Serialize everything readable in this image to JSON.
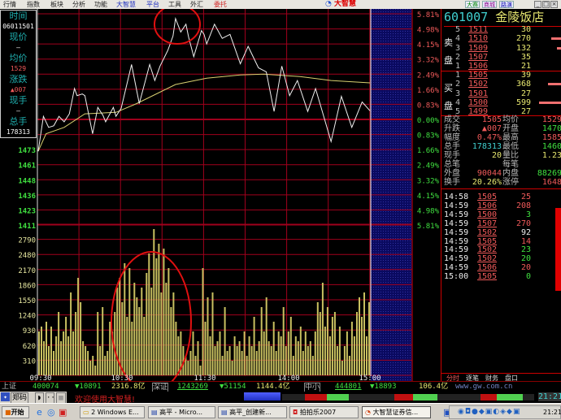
{
  "menu": {
    "items": [
      "行情",
      "指数",
      "板块",
      "分析",
      "功能",
      "大智慧",
      "平台",
      "工具",
      "外汇",
      "委托"
    ],
    "logo": "大智慧",
    "top_buttons": [
      "大赛",
      "商城",
      "路演"
    ],
    "window": [
      "_",
      "□",
      "×"
    ]
  },
  "info": {
    "time_label": "时间",
    "time_value": "06011501",
    "price_label": "现价",
    "price_value": "—",
    "avg_label": "均价",
    "avg_value": "1529",
    "chg_label": "涨跌",
    "chg_value": "▲007",
    "vol_label": "现手",
    "vol_value": "—",
    "total_label": "总手",
    "total_value": "178313"
  },
  "axes": {
    "price_labels": [
      "1473",
      "1461",
      "1448",
      "1436",
      "1423",
      "1411"
    ],
    "pct_labels": [
      "5.81%",
      "4.98%",
      "4.15%",
      "3.32%",
      "2.49%",
      "1.66%",
      "0.83%",
      "0.00%",
      "0.83%",
      "1.66%",
      "2.49%",
      "3.32%",
      "4.15%",
      "4.98%",
      "5.81%"
    ],
    "volume_labels": [
      "2790",
      "2480",
      "2170",
      "1860",
      "1550",
      "1240",
      "930",
      "620",
      "310"
    ],
    "time_labels": [
      "09:30",
      "10:30",
      "11:30",
      "14:00",
      "15:00"
    ]
  },
  "chart_data": {
    "type": "line",
    "pct_range": [
      -5.81,
      5.81
    ],
    "volume_max": 3100,
    "price_pct": [
      [
        0,
        -1.75
      ],
      [
        2,
        0.17
      ],
      [
        4,
        -0.44
      ],
      [
        6,
        -0.35
      ],
      [
        8,
        0.17
      ],
      [
        10,
        -0.13
      ],
      [
        12,
        0.31
      ],
      [
        14,
        1.7
      ],
      [
        15,
        1.31
      ],
      [
        17,
        1.4
      ],
      [
        18,
        1.31
      ],
      [
        21,
        -0.79
      ],
      [
        23,
        0.66
      ],
      [
        25,
        0.22
      ],
      [
        26,
        -0.13
      ],
      [
        29,
        0.66
      ],
      [
        30,
        0.17
      ],
      [
        32,
        0.61
      ],
      [
        36,
        3.02
      ],
      [
        39,
        0.87
      ],
      [
        43,
        3.02
      ],
      [
        45,
        2.14
      ],
      [
        47,
        2.93
      ],
      [
        50,
        3.8
      ],
      [
        52,
        4.59
      ],
      [
        53,
        5.55
      ],
      [
        55,
        4.81
      ],
      [
        57,
        5.24
      ],
      [
        58,
        4.54
      ],
      [
        60,
        3.45
      ],
      [
        63,
        4.89
      ],
      [
        64,
        4.68
      ],
      [
        65,
        4.15
      ],
      [
        68,
        5.24
      ],
      [
        71,
        4.46
      ],
      [
        74,
        4.68
      ],
      [
        78,
        3.06
      ],
      [
        81,
        4.02
      ],
      [
        85,
        2.84
      ],
      [
        88,
        2.62
      ],
      [
        91,
        0.44
      ],
      [
        94,
        2.93
      ],
      [
        97,
        1.31
      ],
      [
        100,
        2.14
      ],
      [
        104,
        0.44
      ],
      [
        107,
        1.7
      ],
      [
        109,
        0.74
      ],
      [
        113,
        -1.22
      ],
      [
        117,
        1.27
      ],
      [
        121,
        -0.44
      ],
      [
        125,
        0.96
      ],
      [
        128,
        0.48
      ]
    ],
    "avg_pct": [
      [
        0,
        -1.75
      ],
      [
        3,
        -0.79
      ],
      [
        10,
        -0.44
      ],
      [
        18,
        0.31
      ],
      [
        30,
        0.39
      ],
      [
        38,
        0.87
      ],
      [
        53,
        1.92
      ],
      [
        65,
        2.27
      ],
      [
        78,
        2.45
      ],
      [
        87,
        2.49
      ],
      [
        101,
        2.36
      ],
      [
        113,
        2.14
      ],
      [
        128,
        2.01
      ]
    ],
    "x_max": 128,
    "volume": [
      900,
      1000,
      700,
      1100,
      600,
      1000,
      500,
      800,
      1300,
      700,
      900,
      1200,
      800,
      1700,
      900,
      1300,
      2000,
      1500,
      700,
      600,
      500,
      300,
      400,
      200,
      1300,
      600,
      1400,
      400,
      500,
      1100,
      900,
      1300,
      1800,
      2000,
      1500,
      2300,
      1200,
      2200,
      1100,
      1900,
      1600,
      1400,
      1800,
      1200,
      2100,
      2500,
      1800,
      3000,
      2400,
      2700,
      1700,
      2600,
      1900,
      2200,
      1400,
      1700,
      1100,
      800,
      900,
      600,
      400,
      300,
      500,
      900,
      400,
      700,
      200,
      2200,
      1100,
      1600,
      800,
      1700,
      600,
      700,
      900,
      400,
      1400,
      500,
      600,
      300,
      800,
      600,
      700,
      500,
      900,
      400,
      800,
      600,
      1200,
      500,
      700,
      1400,
      900,
      1600,
      700,
      600,
      1100,
      500,
      900,
      800,
      1400,
      600,
      900,
      1200,
      400,
      800,
      700,
      1000,
      500,
      900,
      600,
      700,
      400,
      900,
      1500,
      1300,
      1900,
      1000,
      1400,
      800,
      1200,
      1300,
      600,
      1000,
      300,
      600,
      900,
      400,
      1100,
      800,
      1300,
      1600,
      1200,
      1700,
      800,
      1500
    ]
  },
  "stock": {
    "code": "601007",
    "name": "金陵饭店"
  },
  "orderbook": {
    "sell_label": [
      "卖",
      "盘"
    ],
    "buy_label": [
      "买",
      "盘"
    ],
    "sell": [
      {
        "lvl": "5",
        "price": "1511",
        "vol": "30"
      },
      {
        "lvl": "4",
        "price": "1510",
        "vol": "270",
        "depth": 0.45
      },
      {
        "lvl": "3",
        "price": "1509",
        "vol": "132",
        "depth": 0.2
      },
      {
        "lvl": "2",
        "price": "1507",
        "vol": "35"
      },
      {
        "lvl": "1",
        "price": "1506",
        "vol": "21"
      }
    ],
    "buy": [
      {
        "lvl": "1",
        "price": "1505",
        "vol": "39"
      },
      {
        "lvl": "2",
        "price": "1502",
        "vol": "368",
        "depth": 0.6
      },
      {
        "lvl": "3",
        "price": "1501",
        "vol": "27"
      },
      {
        "lvl": "4",
        "price": "1500",
        "vol": "599",
        "depth": 1
      },
      {
        "lvl": "5",
        "price": "1499",
        "vol": "27"
      }
    ]
  },
  "stats": [
    {
      "l1": "成交",
      "v1": "1505",
      "c1": "red",
      "l2": "均价",
      "v2": "1529",
      "c2": "red"
    },
    {
      "l1": "升跌",
      "v1": "▲007",
      "c1": "red",
      "l2": "开盘",
      "v2": "1470",
      "c2": "grn"
    },
    {
      "l1": "幅度",
      "v1": "0.47%",
      "c1": "red",
      "l2": "最高",
      "v2": "1585",
      "c2": "red"
    },
    {
      "l1": "总手",
      "v1": "178313",
      "c1": "cya",
      "l2": "最低",
      "v2": "1460",
      "c2": "grn"
    },
    {
      "l1": "现手",
      "v1": "20",
      "c1": "yel",
      "l2": "量比",
      "v2": "1.23",
      "c2": "yel"
    },
    {
      "l1": "总笔",
      "v1": "",
      "c1": "wht",
      "l2": "每笔",
      "v2": "",
      "c2": "wht"
    },
    {
      "l1": "外盘",
      "v1": "90044",
      "c1": "red",
      "l2": "内盘",
      "v2": "88269",
      "c2": "grn"
    },
    {
      "l1": "换手",
      "v1": "20.26%",
      "c1": "yel",
      "l2": "涨停",
      "v2": "1648",
      "c2": "red"
    }
  ],
  "trades": [
    {
      "t": "14:58",
      "p": "1505",
      "v": "25",
      "c": "red"
    },
    {
      "t": "14:59",
      "p": "1506",
      "v": "208",
      "c": "red"
    },
    {
      "t": "14:59",
      "p": "1500",
      "v": "3",
      "c": "grn"
    },
    {
      "t": "14:59",
      "p": "1507",
      "v": "270",
      "c": "red"
    },
    {
      "t": "14:59",
      "p": "1502",
      "v": "92",
      "c": "wht"
    },
    {
      "t": "14:59",
      "p": "1505",
      "v": "14",
      "c": "red"
    },
    {
      "t": "14:59",
      "p": "1502",
      "v": "23",
      "c": "grn"
    },
    {
      "t": "14:59",
      "p": "1502",
      "v": "20",
      "c": "grn"
    },
    {
      "t": "14:59",
      "p": "1506",
      "v": "20",
      "c": "red"
    },
    {
      "t": "15:00",
      "p": "1505",
      "v": "0",
      "c": "grn"
    }
  ],
  "tabs": [
    "分时",
    "逐笔",
    "财务",
    "盘口"
  ],
  "status": {
    "sh_label": "上证",
    "sh_index": "400074",
    "sh_chg": "▼10891",
    "sh_amt": "2316.8亿",
    "sz_label": "深证",
    "sz_index": "1243269",
    "sz_chg": "▼51154",
    "sz_amt": "1144.4亿",
    "zx_label": "中小",
    "zx_index": "444801",
    "zx_chg": "▼18893",
    "zx_amt": "106.4亿",
    "site": "www.gw.com.cn"
  },
  "row2": {
    "input_mode": "郑码",
    "welcome": "欢迎使用大智慧!",
    "clock": "21:21"
  },
  "taskbar": {
    "start": "开始",
    "tasks": [
      "2 Windows E...",
      "高平 - Micro...",
      "高平_创建新...",
      "拍拍乐2007",
      "大智慧证券信..."
    ],
    "clock": "21:21"
  },
  "colors": {
    "grid": "#a0001c",
    "price": "#f0f0f0",
    "avg": "#d8d070",
    "volume": "#c8c060",
    "hatch": "#101070"
  }
}
